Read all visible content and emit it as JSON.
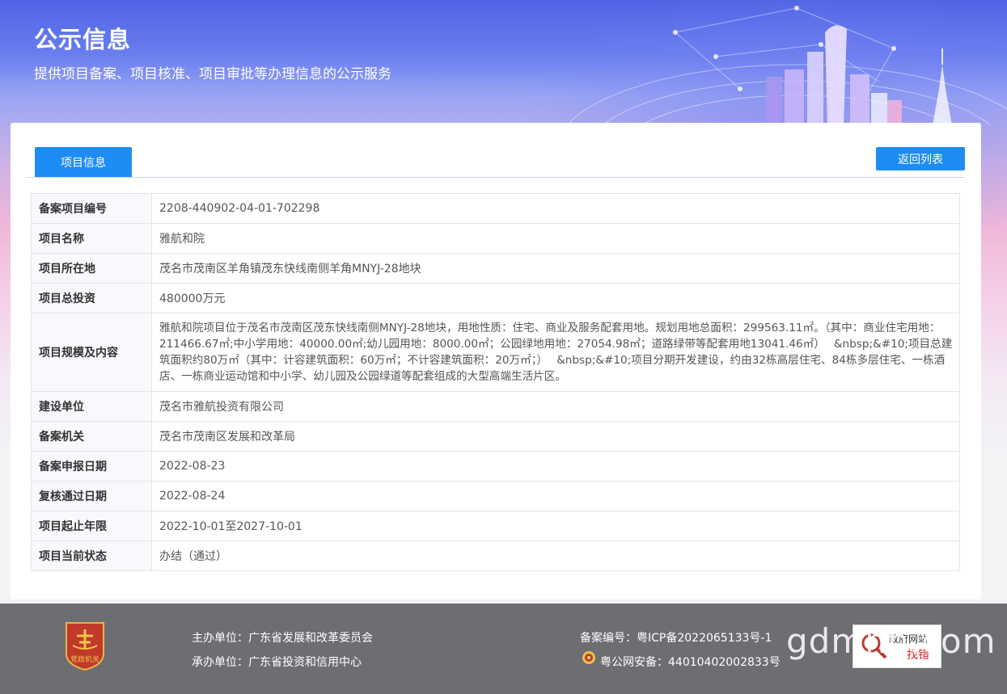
{
  "banner": {
    "title": "公示信息",
    "subtitle": "提供项目备案、项目核准、项目审批等办理信息的公示服务"
  },
  "tab_label": "项目信息",
  "back_button": "返回列表",
  "rows": [
    {
      "key": "备案项目编号",
      "value": "2208-440902-04-01-702298"
    },
    {
      "key": "项目名称",
      "value": "雅航和院"
    },
    {
      "key": "项目所在地",
      "value": "茂名市茂南区羊角镇茂东快线南侧羊角MNYJ-28地块"
    },
    {
      "key": "项目总投资",
      "value": "480000万元"
    },
    {
      "key": "项目规模及内容",
      "value": "雅航和院项目位于茂名市茂南区茂东快线南侧MNYJ-28地块，用地性质：住宅、商业及服务配套用地。规划用地总面积：299563.11㎡。（其中：商业住宅用地：211466.67㎡;中小学用地：40000.00㎡;幼儿园用地：8000.00㎡；公园绿地用地：27054.98㎡；道路绿带等配套用地13041.46㎡）　 &nbsp;&#10;项目总建筑面积约80万㎡（其中：计容建筑面积：60万㎡；不计容建筑面积：20万㎡；）　 &nbsp;&#10;项目分期开发建设，约由32栋高层住宅、84栋多层住宅、一栋酒店、一栋商业运动馆和中小学、幼儿园及公园绿道等配套组成的大型高端生活片区。"
    },
    {
      "key": "建设单位",
      "value": "茂名市雅航投资有限公司"
    },
    {
      "key": "备案机关",
      "value": "茂名市茂南区发展和改革局"
    },
    {
      "key": "备案申报日期",
      "value": "2022-08-23"
    },
    {
      "key": "复核通过日期",
      "value": "2022-08-24"
    },
    {
      "key": "项目起止年限",
      "value": "2022-10-01至2027-10-01"
    },
    {
      "key": "项目当前状态",
      "value": "办结（通过）"
    }
  ],
  "footer": {
    "sponsor": "主办单位：广东省发展和改革委员会",
    "organizer": "承办单位：广东省投资和信用中心",
    "icp": "备案编号：粤ICP备2022065133号-1",
    "police": "粤公网安备：44010402002833号",
    "emblem_text": "党政机关",
    "report_title": "政府网站",
    "report_label": "找错",
    "watermark": "gdmnn.com"
  }
}
